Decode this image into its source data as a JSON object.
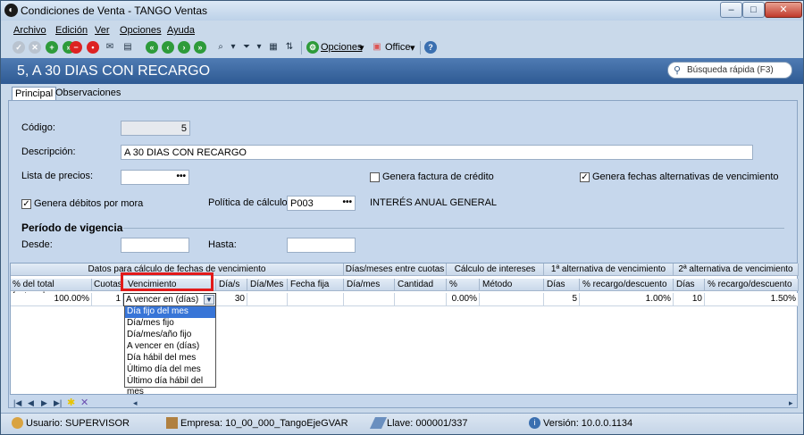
{
  "window": {
    "title": "Condiciones de Venta - TANGO Ventas",
    "minimize": "–",
    "maximize": "□",
    "close": "✕"
  },
  "menu": [
    "Archivo",
    "Edición",
    "Ver",
    "Opciones",
    "Ayuda"
  ],
  "toolbar": {
    "opciones_label": "Opciones",
    "office_label": "Office",
    "help": "?"
  },
  "header": {
    "title": "5, A 30 DIAS CON RECARGO",
    "search_placeholder": "Búsqueda rápida (F3)"
  },
  "tabs": [
    "Principal",
    "Observaciones"
  ],
  "form": {
    "codigo_label": "Código:",
    "codigo_value": "5",
    "descripcion_label": "Descripción:",
    "descripcion_value": "A 30 DIAS CON RECARGO",
    "lista_label": "Lista de precios:",
    "lista_value": "",
    "genera_factura_label": "Genera factura de crédito",
    "genera_factura_checked": false,
    "genera_fechas_label": "Genera fechas alternativas de vencimiento",
    "genera_fechas_checked": true,
    "genera_debitos_label": "Genera débitos por mora",
    "genera_debitos_checked": true,
    "politica_label": "Política de cálculo:",
    "politica_value": "P003",
    "politica_desc": "INTERÉS ANUAL GENERAL",
    "vigencia_title": "Período de vigencia",
    "desde_label": "Desde:",
    "desde_value": "",
    "hasta_label": "Hasta:",
    "hasta_value": ""
  },
  "grid": {
    "groups": [
      "Datos para cálculo de fechas de vencimiento",
      "Días/meses entre cuotas",
      "Cálculo de intereses",
      "1ª alternativa de vencimiento",
      "2ª alternativa de vencimiento"
    ],
    "columns": [
      "% del total facturado",
      "Cuotas",
      "Vencimiento",
      "Día/s",
      "Día/Mes",
      "Fecha fija",
      "Día/mes",
      "Cantidad",
      "%",
      "Método",
      "Días",
      "% recargo/descuento",
      "Días",
      "% recargo/descuento"
    ],
    "row": {
      "pct_total": "100.00%",
      "cuotas": "1",
      "vencimiento": "A vencer en (días)",
      "dias": "30",
      "dia_mes": "",
      "fecha_fija": "",
      "dm_entre": "",
      "cantidad": "",
      "pct": "0.00%",
      "metodo": "",
      "alt1_dias": "5",
      "alt1_pct": "1.00%",
      "alt2_dias": "10",
      "alt2_pct": "1.50%"
    },
    "dropdown_options": [
      "Día fijo del mes",
      "Día/mes fijo",
      "Día/mes/año fijo",
      "A vencer en (días)",
      "Día hábil del mes",
      "Último día del mes",
      "Último día hábil del mes"
    ],
    "dropdown_selected": 0
  },
  "status": {
    "usuario": "Usuario: SUPERVISOR",
    "empresa": "Empresa: 10_00_000_TangoEjeGVAR",
    "llave": "Llave: 000001/337",
    "version": "Versión: 10.0.0.1134"
  }
}
